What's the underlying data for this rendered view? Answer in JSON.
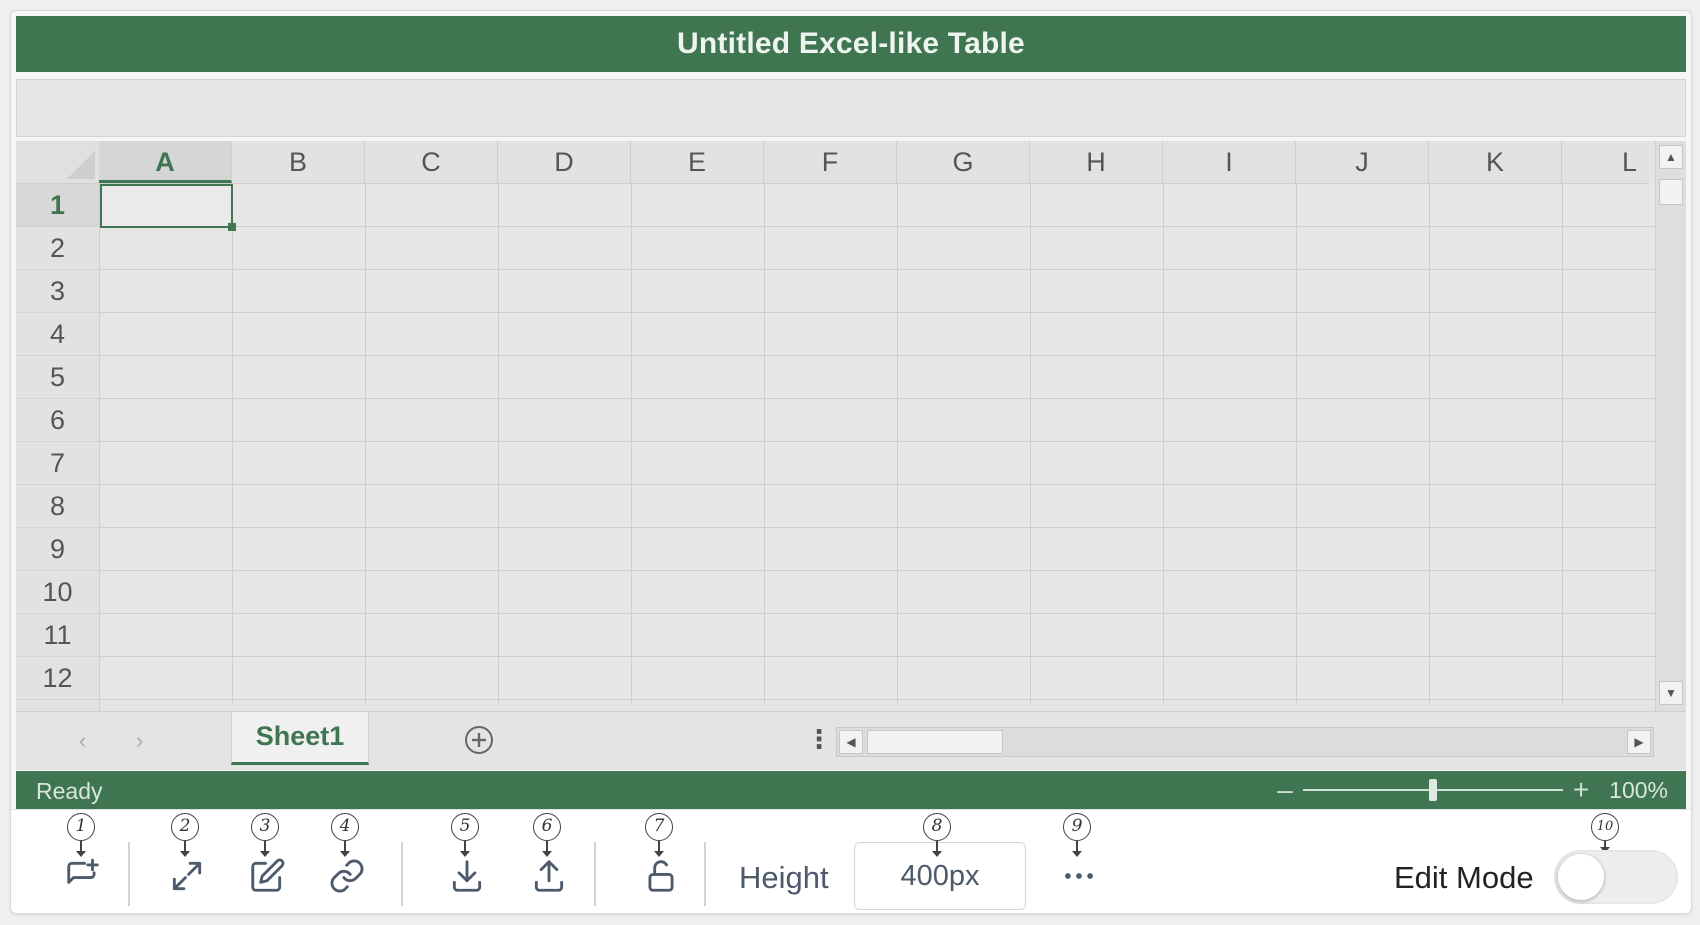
{
  "window": {
    "title": "Untitled Excel-like Table"
  },
  "grid": {
    "columns": [
      "A",
      "B",
      "C",
      "D",
      "E",
      "F",
      "G",
      "H",
      "I",
      "J",
      "K",
      "L"
    ],
    "rows": [
      "1",
      "2",
      "3",
      "4",
      "5",
      "6",
      "7",
      "8",
      "9",
      "10",
      "11",
      "12"
    ],
    "selected_cell": "A1"
  },
  "sheets": {
    "tabs": [
      {
        "label": "Sheet1",
        "active": true
      }
    ]
  },
  "status": {
    "text": "Ready",
    "zoom": "100%"
  },
  "toolbar": {
    "items": [
      {
        "badge": "1",
        "icon": "add-comment-icon"
      },
      {
        "badge": "2",
        "icon": "expand-icon"
      },
      {
        "badge": "3",
        "icon": "edit-icon"
      },
      {
        "badge": "4",
        "icon": "link-icon"
      },
      {
        "badge": "5",
        "icon": "download-icon"
      },
      {
        "badge": "6",
        "icon": "upload-icon"
      },
      {
        "badge": "7",
        "icon": "unlock-icon"
      },
      {
        "badge": "8",
        "icon": "height-field"
      },
      {
        "badge": "9",
        "icon": "more-icon"
      },
      {
        "badge": "10",
        "icon": "edit-mode-toggle"
      }
    ],
    "height_label": "Height",
    "height_value": "400px",
    "edit_mode_label": "Edit Mode",
    "edit_mode_on": false
  },
  "colors": {
    "accent": "#3f7550",
    "toolbar_icon": "#4c5a6c"
  }
}
